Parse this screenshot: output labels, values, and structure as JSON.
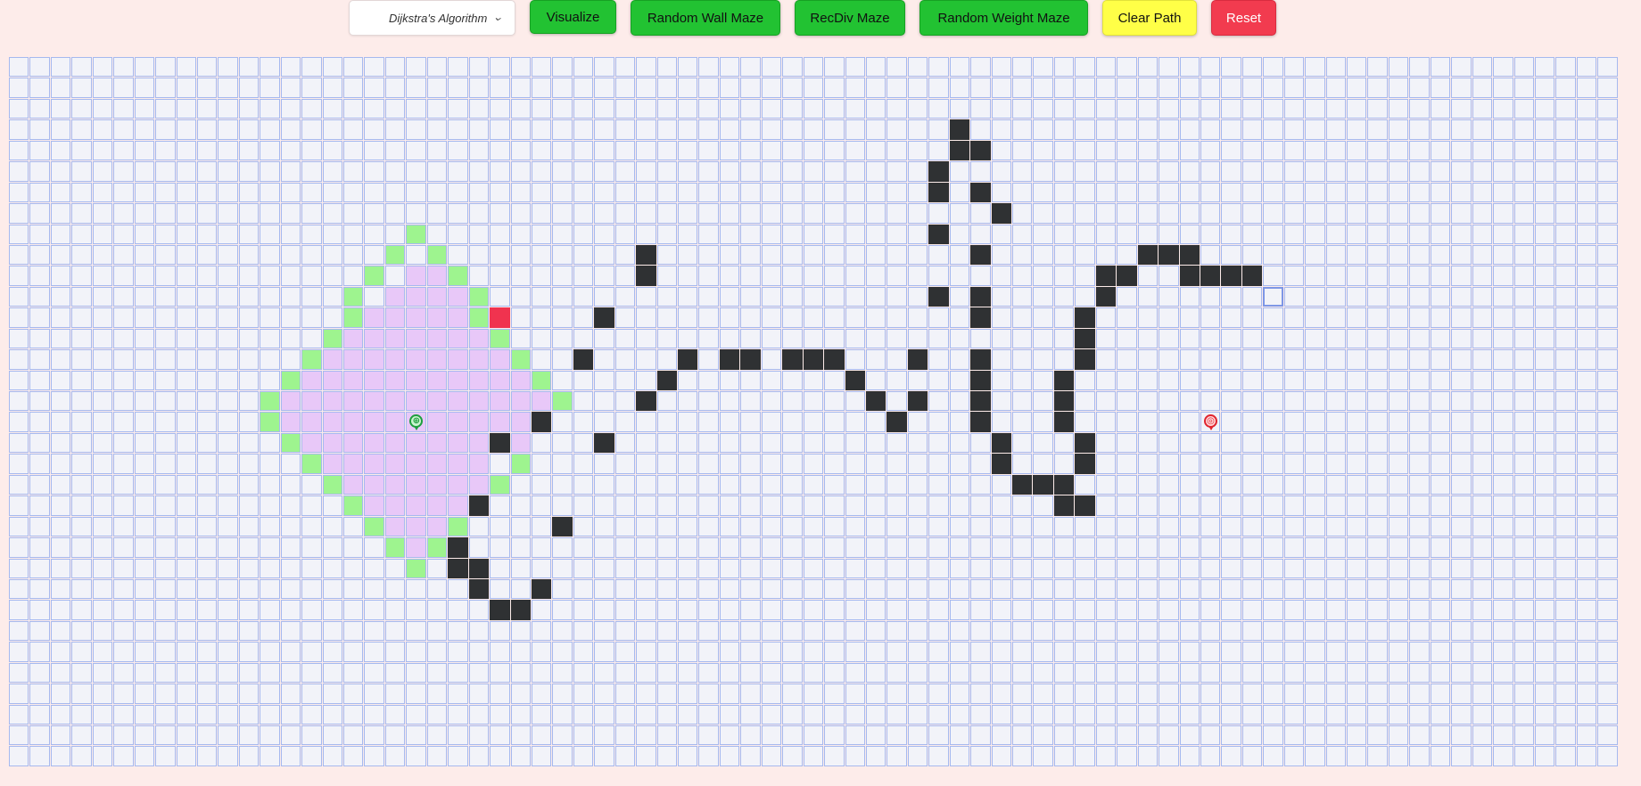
{
  "toolbar": {
    "algorithm_select": {
      "selected": "Dijkstra's Algorithm"
    },
    "visualize_label": "Visualize",
    "random_wall_maze_label": "Random Wall Maze",
    "recdiv_maze_label": "RecDiv Maze",
    "random_weight_maze_label": "Random Weight Maze",
    "clear_path_label": "Clear Path",
    "reset_label": "Reset"
  },
  "colors": {
    "background": "#fdecea",
    "cell": "#f2f3f9",
    "cell_border": "#a6b9ef",
    "visited": "#e8c8f8",
    "frontier": "#9ef48f",
    "wall": "#2f3133",
    "red_wall": "#f0334f",
    "button_green": "#22c232",
    "button_yellow": "#ffff47",
    "button_red": "#f23b4f"
  },
  "grid": {
    "rows": 34,
    "cols": 77,
    "start_node": {
      "row": 17,
      "col": 19,
      "icon": "start-pin-icon"
    },
    "target_node": {
      "row": 17,
      "col": 57,
      "icon": "target-pin-icon"
    },
    "hovered_node": {
      "row": 11,
      "col": 60
    },
    "walls": [
      [
        3,
        45
      ],
      [
        4,
        45
      ],
      [
        4,
        46
      ],
      [
        5,
        44
      ],
      [
        6,
        44
      ],
      [
        6,
        46
      ],
      [
        7,
        47
      ],
      [
        8,
        44
      ],
      [
        9,
        30
      ],
      [
        9,
        46
      ],
      [
        9,
        54
      ],
      [
        9,
        55
      ],
      [
        9,
        56
      ],
      [
        10,
        30
      ],
      [
        10,
        52
      ],
      [
        10,
        53
      ],
      [
        10,
        56
      ],
      [
        10,
        57
      ],
      [
        10,
        58
      ],
      [
        10,
        59
      ],
      [
        11,
        44
      ],
      [
        11,
        46
      ],
      [
        11,
        52
      ],
      [
        12,
        28
      ],
      [
        12,
        46
      ],
      [
        12,
        51
      ],
      [
        13,
        51
      ],
      [
        14,
        27
      ],
      [
        14,
        32
      ],
      [
        14,
        34
      ],
      [
        14,
        35
      ],
      [
        14,
        37
      ],
      [
        14,
        38
      ],
      [
        14,
        39
      ],
      [
        14,
        43
      ],
      [
        14,
        46
      ],
      [
        14,
        51
      ],
      [
        15,
        31
      ],
      [
        15,
        40
      ],
      [
        15,
        46
      ],
      [
        15,
        50
      ],
      [
        16,
        30
      ],
      [
        16,
        41
      ],
      [
        16,
        43
      ],
      [
        16,
        46
      ],
      [
        16,
        50
      ],
      [
        17,
        25
      ],
      [
        17,
        42
      ],
      [
        17,
        46
      ],
      [
        17,
        50
      ],
      [
        18,
        23
      ],
      [
        18,
        28
      ],
      [
        18,
        47
      ],
      [
        18,
        51
      ],
      [
        18,
        47
      ],
      [
        19,
        47
      ],
      [
        19,
        51
      ],
      [
        20,
        48
      ],
      [
        20,
        49
      ],
      [
        20,
        50
      ],
      [
        21,
        22
      ],
      [
        21,
        50
      ],
      [
        21,
        51
      ],
      [
        22,
        26
      ],
      [
        23,
        21
      ],
      [
        24,
        21
      ],
      [
        24,
        22
      ],
      [
        25,
        22
      ],
      [
        25,
        25
      ],
      [
        26,
        23
      ],
      [
        26,
        24
      ]
    ],
    "red_walls": [
      [
        12,
        23
      ]
    ],
    "visited": [
      [
        10,
        19
      ],
      [
        10,
        20
      ],
      [
        11,
        18
      ],
      [
        11,
        19
      ],
      [
        11,
        20
      ],
      [
        11,
        21
      ],
      [
        12,
        17
      ],
      [
        12,
        18
      ],
      [
        12,
        19
      ],
      [
        12,
        20
      ],
      [
        12,
        21
      ],
      [
        13,
        16
      ],
      [
        13,
        17
      ],
      [
        13,
        18
      ],
      [
        13,
        19
      ],
      [
        13,
        20
      ],
      [
        13,
        21
      ],
      [
        13,
        22
      ],
      [
        14,
        15
      ],
      [
        14,
        16
      ],
      [
        14,
        17
      ],
      [
        14,
        18
      ],
      [
        14,
        19
      ],
      [
        14,
        20
      ],
      [
        14,
        21
      ],
      [
        14,
        22
      ],
      [
        14,
        23
      ],
      [
        15,
        14
      ],
      [
        15,
        15
      ],
      [
        15,
        16
      ],
      [
        15,
        17
      ],
      [
        15,
        18
      ],
      [
        15,
        19
      ],
      [
        15,
        20
      ],
      [
        15,
        21
      ],
      [
        15,
        22
      ],
      [
        15,
        23
      ],
      [
        15,
        24
      ],
      [
        16,
        13
      ],
      [
        16,
        14
      ],
      [
        16,
        15
      ],
      [
        16,
        16
      ],
      [
        16,
        17
      ],
      [
        16,
        18
      ],
      [
        16,
        19
      ],
      [
        16,
        20
      ],
      [
        16,
        21
      ],
      [
        16,
        22
      ],
      [
        16,
        23
      ],
      [
        16,
        24
      ],
      [
        16,
        25
      ],
      [
        17,
        13
      ],
      [
        17,
        14
      ],
      [
        17,
        15
      ],
      [
        17,
        16
      ],
      [
        17,
        17
      ],
      [
        17,
        18
      ],
      [
        17,
        19
      ],
      [
        17,
        20
      ],
      [
        17,
        21
      ],
      [
        17,
        22
      ],
      [
        17,
        23
      ],
      [
        17,
        24
      ],
      [
        18,
        14
      ],
      [
        18,
        15
      ],
      [
        18,
        16
      ],
      [
        18,
        17
      ],
      [
        18,
        18
      ],
      [
        18,
        19
      ],
      [
        18,
        20
      ],
      [
        18,
        21
      ],
      [
        18,
        22
      ],
      [
        18,
        23
      ],
      [
        18,
        24
      ],
      [
        19,
        15
      ],
      [
        19,
        16
      ],
      [
        19,
        17
      ],
      [
        19,
        18
      ],
      [
        19,
        19
      ],
      [
        19,
        20
      ],
      [
        19,
        21
      ],
      [
        19,
        22
      ],
      [
        20,
        16
      ],
      [
        20,
        17
      ],
      [
        20,
        18
      ],
      [
        20,
        19
      ],
      [
        20,
        20
      ],
      [
        20,
        21
      ],
      [
        20,
        22
      ],
      [
        21,
        17
      ],
      [
        21,
        18
      ],
      [
        21,
        19
      ],
      [
        21,
        20
      ],
      [
        21,
        21
      ],
      [
        22,
        18
      ],
      [
        22,
        19
      ],
      [
        22,
        20
      ],
      [
        23,
        19
      ],
      [
        23,
        20
      ]
    ],
    "frontier": [
      [
        8,
        19
      ],
      [
        9,
        18
      ],
      [
        9,
        20
      ],
      [
        10,
        17
      ],
      [
        10,
        21
      ],
      [
        11,
        16
      ],
      [
        11,
        22
      ],
      [
        12,
        16
      ],
      [
        12,
        22
      ],
      [
        13,
        15
      ],
      [
        13,
        23
      ],
      [
        14,
        14
      ],
      [
        14,
        24
      ],
      [
        15,
        13
      ],
      [
        15,
        25
      ],
      [
        16,
        12
      ],
      [
        16,
        26
      ],
      [
        17,
        12
      ],
      [
        18,
        13
      ],
      [
        19,
        14
      ],
      [
        19,
        24
      ],
      [
        20,
        15
      ],
      [
        20,
        23
      ],
      [
        21,
        16
      ],
      [
        22,
        17
      ],
      [
        22,
        21
      ],
      [
        23,
        18
      ],
      [
        23,
        20
      ],
      [
        24,
        19
      ]
    ]
  }
}
